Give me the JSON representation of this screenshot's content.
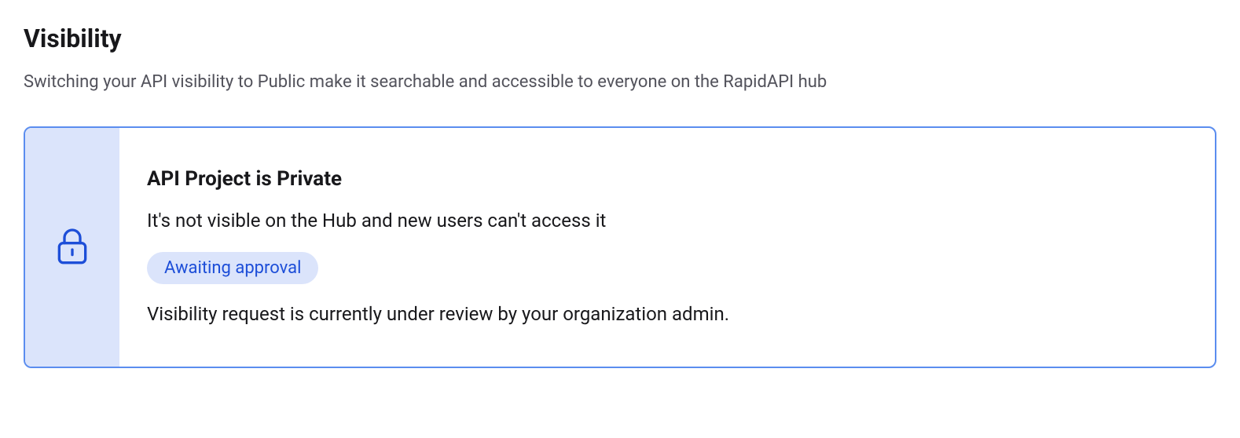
{
  "section": {
    "title": "Visibility",
    "description": "Switching your API visibility to Public make it searchable and accessible to everyone on the RapidAPI hub"
  },
  "card": {
    "title": "API Project is Private",
    "subtitle": "It's not visible on the Hub and new users can't access it",
    "status_badge": "Awaiting approval",
    "note": "Visibility request is currently under review by your organization admin."
  }
}
